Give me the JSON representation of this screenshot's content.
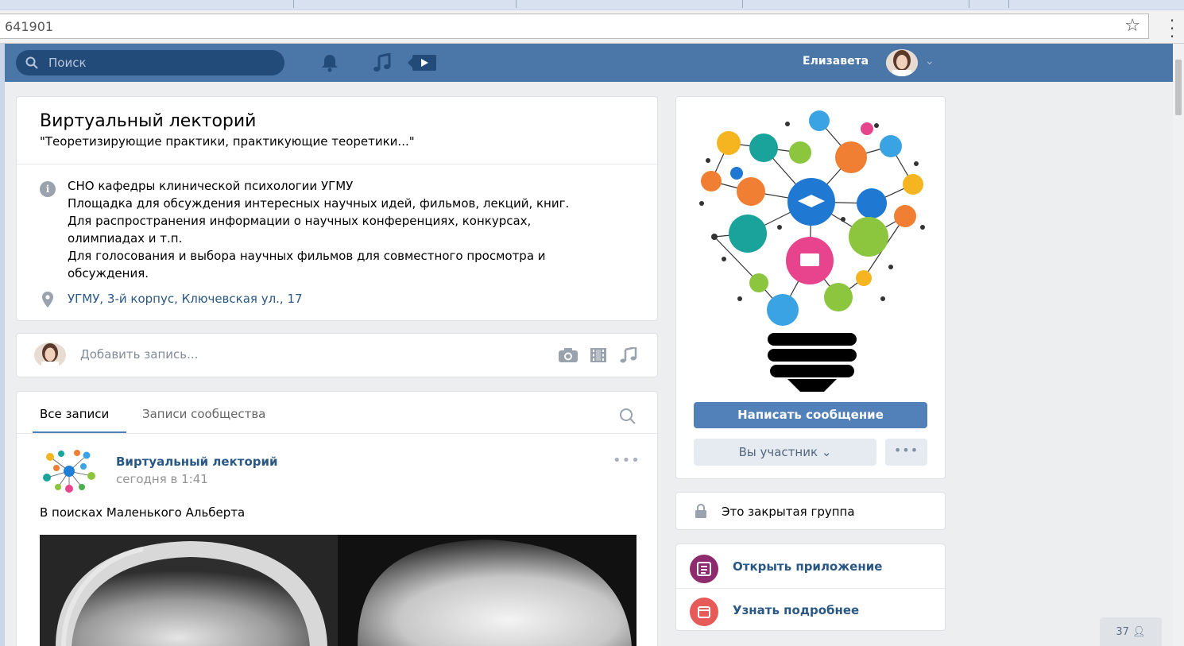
{
  "browser": {
    "url": "641901",
    "star_icon": "star-icon",
    "menu_icon": "vertical-dots-icon"
  },
  "header": {
    "search_placeholder": "Поиск",
    "user_name": "Елизавета",
    "icons": [
      "search-icon",
      "bell-icon",
      "music-note-icon",
      "video-play-icon",
      "chevron-down-icon"
    ],
    "accent": "#4a76a8"
  },
  "group": {
    "title": "Виртуальный лекторий",
    "status": "\"Теоретизирующие практики, практикующие теоретики...\"",
    "description_lines": [
      "СНО кафедры клинической психологии УГМУ",
      "Площадка для обсуждения интересных научных идей, фильмов, лекций, книг.",
      "Для распространения информации о научных конференциях, конкурсах,",
      "олимпиадах и т.п.",
      "Для голосования и выбора научных фильмов для совместного просмотра и",
      "обсуждения."
    ],
    "address": "УГМУ, 3-й корпус, Ключевская ул., 17"
  },
  "composer": {
    "placeholder": "Добавить запись..."
  },
  "wall": {
    "tabs": [
      {
        "label": "Все записи",
        "active": true
      },
      {
        "label": "Записи сообщества",
        "active": false
      }
    ],
    "post": {
      "author": "Виртуальный лекторий",
      "date": "сегодня в 1:41",
      "more": "•••",
      "text": "В поисках Маленького Альберта"
    }
  },
  "sidebar": {
    "write_button": "Написать сообщение",
    "member_button": "Вы участник",
    "more_button": "•••",
    "closed_group": "Это закрытая группа",
    "apps": [
      {
        "label": "Открыть приложение",
        "color": "#8e2a6e"
      },
      {
        "label": "Узнать подробнее",
        "color": "#e65a5a"
      }
    ]
  },
  "footer": {
    "members_count": "37"
  }
}
